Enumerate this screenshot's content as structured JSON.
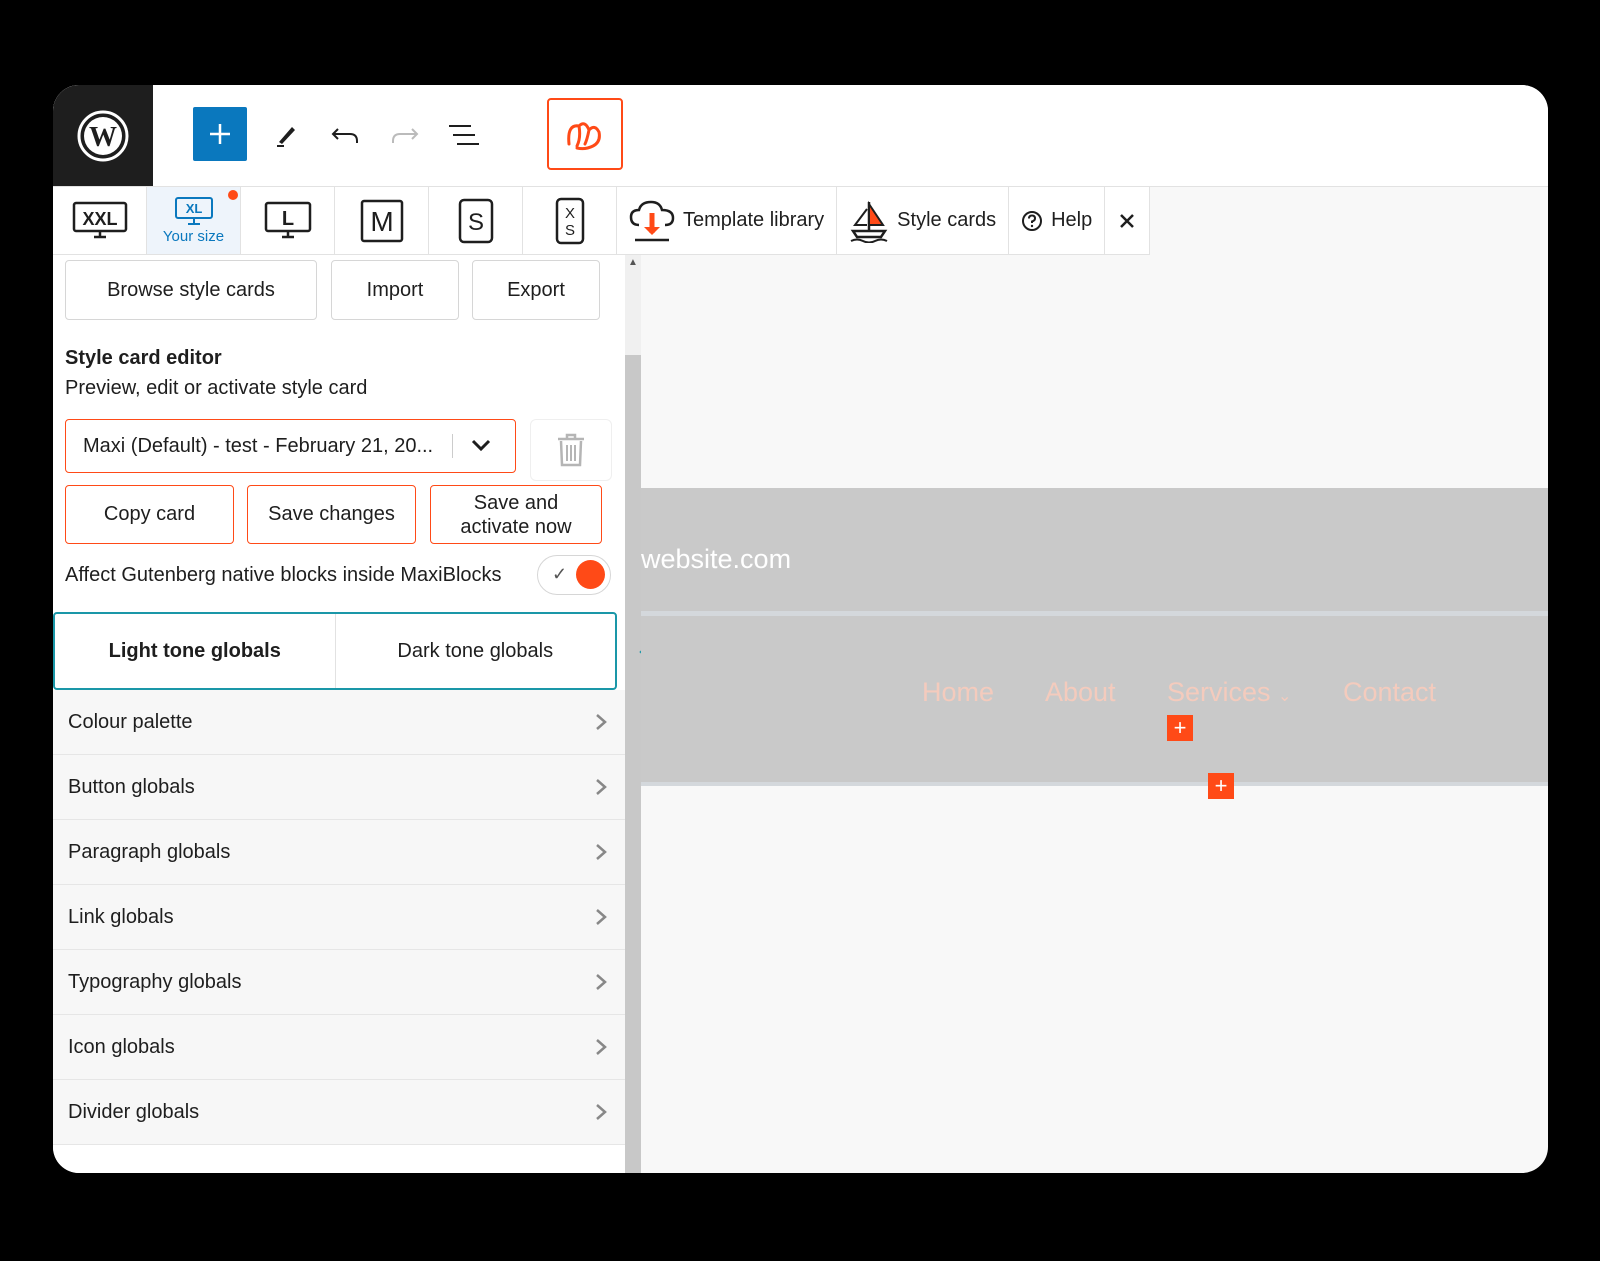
{
  "toolbar": {
    "sizes": [
      {
        "label": "XXL"
      },
      {
        "label": "XL",
        "caption": "Your size"
      },
      {
        "label": "L"
      },
      {
        "label": "M"
      },
      {
        "label": "S"
      },
      {
        "label": "XS"
      }
    ],
    "template_library": "Template library",
    "style_cards": "Style cards",
    "help": "Help"
  },
  "sidebar": {
    "browse": "Browse style cards",
    "import": "Import",
    "export": "Export",
    "editor_title": "Style card editor",
    "editor_subtitle": "Preview, edit or activate style card",
    "selected_card": "Maxi (Default) - test - February 21, 20...",
    "copy_card": "Copy card",
    "save_changes": "Save changes",
    "save_activate_line1": "Save and",
    "save_activate_line2": "activate now",
    "toggle_label": "Affect Gutenberg native blocks inside MaxiBlocks",
    "toggle_on": true,
    "tabs": [
      "Light tone globals",
      "Dark tone globals"
    ],
    "sections": [
      "Colour palette",
      "Button globals",
      "Paragraph globals",
      "Link globals",
      "Typography globals",
      "Icon globals",
      "Divider globals"
    ]
  },
  "canvas": {
    "site_url": "website.com",
    "nav": [
      "Home",
      "About",
      "Services",
      "Contact"
    ]
  },
  "colors": {
    "accent": "#ff4a17",
    "wp_blue": "#0a78be",
    "teal": "#1a97a8"
  }
}
